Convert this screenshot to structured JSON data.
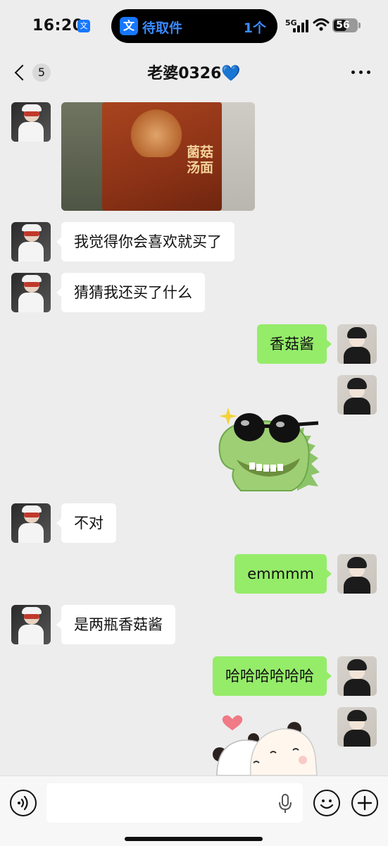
{
  "status_bar": {
    "time": "16:20",
    "app_icon_glyph": "文",
    "island": {
      "icon_glyph": "文",
      "label": "待取件",
      "count": "1个"
    },
    "network": "5G",
    "battery": "56",
    "icons": [
      "signal-icon",
      "wifi-icon",
      "battery-icon"
    ]
  },
  "nav": {
    "unread_count": "5",
    "title": "老婆0326💙",
    "icons": [
      "back-icon",
      "more-icon"
    ]
  },
  "messages": [
    {
      "sender": "them",
      "type": "image",
      "image_text": "菌菇汤面"
    },
    {
      "sender": "them",
      "type": "text",
      "text": "我觉得你会喜欢就买了"
    },
    {
      "sender": "them",
      "type": "text",
      "text": "猜猜我还买了什么"
    },
    {
      "sender": "me",
      "type": "text",
      "text": "香菇酱"
    },
    {
      "sender": "me",
      "type": "sticker",
      "sticker": "green-dinosaur-sunglasses"
    },
    {
      "sender": "them",
      "type": "text",
      "text": "不对"
    },
    {
      "sender": "me",
      "type": "text",
      "text": "emmmm"
    },
    {
      "sender": "them",
      "type": "text",
      "text": "是两瓶香菇酱"
    },
    {
      "sender": "me",
      "type": "text",
      "text": "哈哈哈哈哈哈"
    },
    {
      "sender": "me",
      "type": "sticker",
      "sticker": "bear-and-panda-heart"
    }
  ],
  "input_bar": {
    "value": "",
    "placeholder": "",
    "icons": [
      "voice-icon",
      "mic-icon",
      "emoji-icon",
      "plus-icon"
    ]
  },
  "colors": {
    "background": "#ededed",
    "incoming_bubble": "#ffffff",
    "outgoing_bubble": "#95ec69",
    "island_accent": "#3a8bff"
  }
}
